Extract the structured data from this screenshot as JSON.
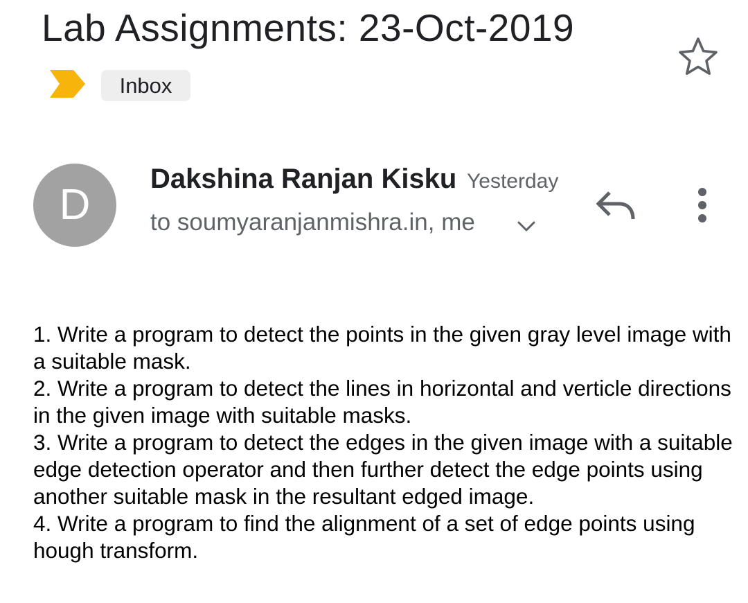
{
  "message": {
    "subject": "Lab Assignments: 23-Oct-2019",
    "label": "Inbox",
    "importance_marker": "important-marker-icon",
    "star_icon": "star-outline-icon",
    "sender": {
      "name": "Dakshina Ranjan Kisku",
      "avatar_initial": "D",
      "avatar_color": "#a2a2a2"
    },
    "time": "Yesterday",
    "recipients": "to soumyaranjanmishra.in, me",
    "actions": {
      "reply_icon": "reply-icon",
      "more_icon": "more-vert-icon",
      "expand_icon": "chevron-down-icon"
    },
    "body": [
      "1. Write a program to detect the points in the given gray level image with a suitable mask.",
      "2. Write a program to detect the lines in horizontal and verticle directions in the given image with suitable masks.",
      "3. Write a program to detect the edges in the given image with a suitable edge detection operator and then further detect the edge points using another suitable mask in the resultant edged image.",
      "4. Write a program to find the alignment of a set of edge points using hough transform."
    ]
  },
  "colors": {
    "importance": "#f7b40b",
    "secondary_text": "#5f6368",
    "chip_background": "#eeeeee"
  }
}
